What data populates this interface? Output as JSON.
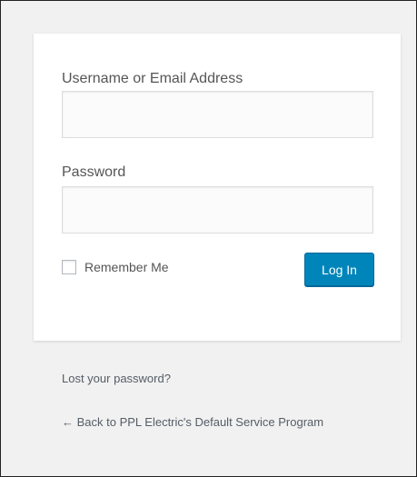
{
  "login_form": {
    "username_label": "Username or Email Address",
    "username_value": "",
    "password_label": "Password",
    "password_value": "",
    "remember_label": "Remember Me",
    "remember_checked": false,
    "submit_label": "Log In"
  },
  "links": {
    "lost_password": "Lost your password?",
    "back_to_site": "← Back to PPL Electric's Default Service Program"
  },
  "colors": {
    "background": "#f1f1f1",
    "card": "#ffffff",
    "primary_button": "#0085ba",
    "text": "#555555"
  }
}
